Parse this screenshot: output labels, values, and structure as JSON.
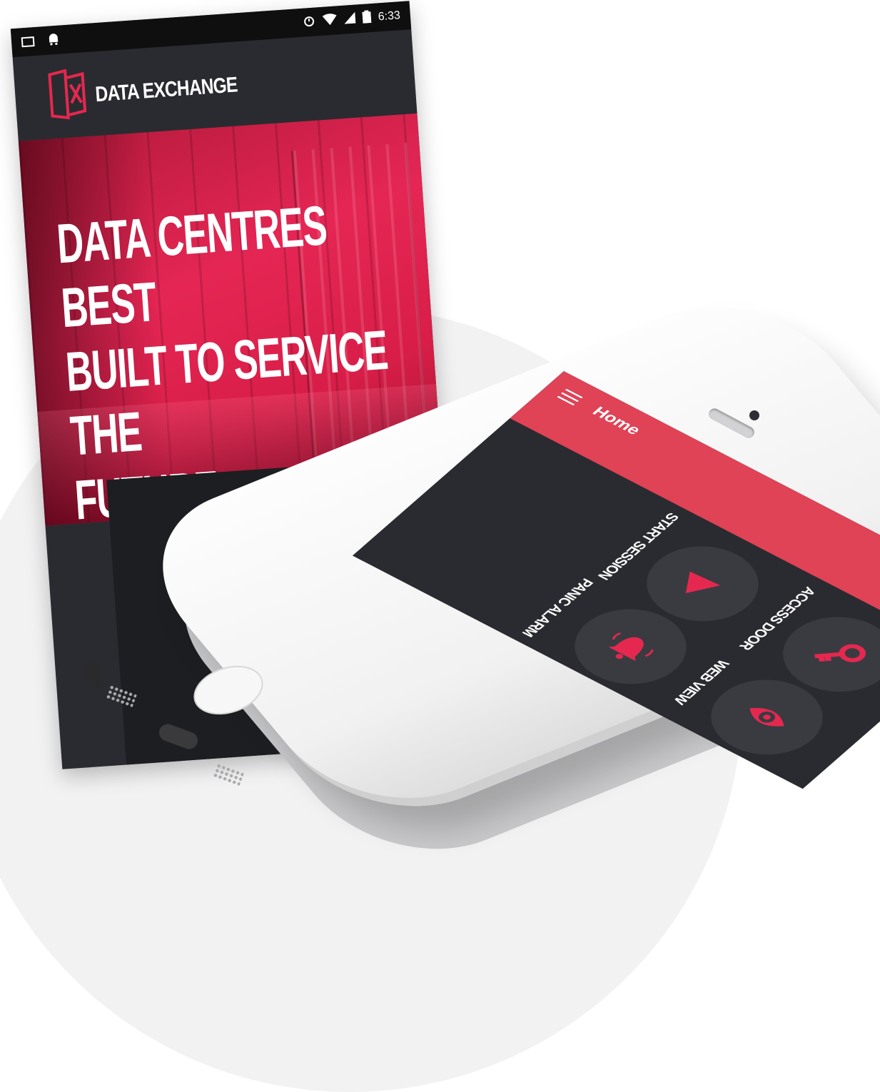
{
  "colors": {
    "accent": "#e04256",
    "hero_red": "#e52654",
    "screen_dark": "#2a2b30",
    "button_dark": "#3a3b41",
    "status_black": "#0f0f10"
  },
  "back_screen": {
    "status_bar": {
      "icons": [
        "image-icon",
        "android-icon",
        "alarm-icon",
        "wifi-icon",
        "signal-icon",
        "battery-icon"
      ],
      "time": "6:33"
    },
    "brand": {
      "logo_icon": "data-exchange-logo-icon",
      "name": "DATA EXCHANGE"
    },
    "headline": [
      "DATA CENTRES BEST",
      "BUILT TO SERVICE THE",
      "FUTURE"
    ]
  },
  "front_app": {
    "appbar": {
      "menu_icon": "hamburger-menu-icon",
      "title": "Home"
    },
    "actions": [
      {
        "label": "START SESSION",
        "icon": "play-icon"
      },
      {
        "label": "PANIC ALARM",
        "icon": "bell-icon"
      },
      {
        "label": "ACCESS DOOR",
        "icon": "key-icon"
      },
      {
        "label": "WEB VIEW",
        "icon": "eye-icon"
      }
    ]
  }
}
